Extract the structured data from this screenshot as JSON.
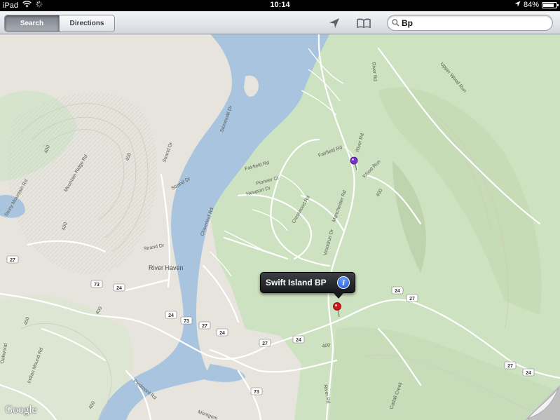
{
  "status_bar": {
    "device": "iPad",
    "time": "10:14",
    "battery": "84%",
    "battery_level": 0.84
  },
  "toolbar": {
    "search_label": "Search",
    "directions_label": "Directions",
    "search_value": "Bp"
  },
  "callout": {
    "title": "Swift Island BP"
  },
  "map": {
    "attribution": "Google",
    "place_labels": {
      "river_haven": "River Haven"
    },
    "road_labels": {
      "river_rd_north": "River Rd",
      "river_rd_mid": "River Rd",
      "river_rd_south": "River Rd",
      "upper_wood_run": "Upper Wood Run",
      "wood_run": "Wood Run",
      "woodrun_dr": "Woodrun Dr",
      "manchester_rd": "Manchester Rd",
      "fairfield_rd_1": "Fairfield Rd",
      "fairfield_rd_2": "Fairfield Rd",
      "pioneer_ct": "Pioneer Ct",
      "newport_dr": "Newport Dr",
      "crestwood_rd": "Crestwood Rd",
      "cloverleaf_rd": "Cloverleaf Rd",
      "stonewall_dr": "Stonewall Dr",
      "strand_dr_1": "Strand Dr",
      "strand_dr_2": "Strand Dr",
      "strand_dr_3": "Strand Dr",
      "mountain_ridge_rd": "Mountain Ridge Rd",
      "stony_mountain_rd": "Stony Mountain Rd",
      "indian_mound_rd": "Indian Mound Rd",
      "piedmont_rd": "Piedmont Rd",
      "montgomery": "Montgom",
      "catfall_creek": "Catfall Creek",
      "oakwood": "Oakwood"
    },
    "contour_labels": [
      "400",
      "400",
      "400",
      "400",
      "400",
      "400",
      "400",
      "400"
    ],
    "route_shields": {
      "s27_west": "27",
      "s73_west": "73",
      "s24_a": "24",
      "s24_b": "24",
      "s73_b": "73",
      "s24_c": "24",
      "s27_c": "27",
      "s24_d": "24",
      "s24_e": "24",
      "s27_e": "27",
      "s27_far": "27",
      "s24_far": "24",
      "s73_south": "73"
    }
  }
}
